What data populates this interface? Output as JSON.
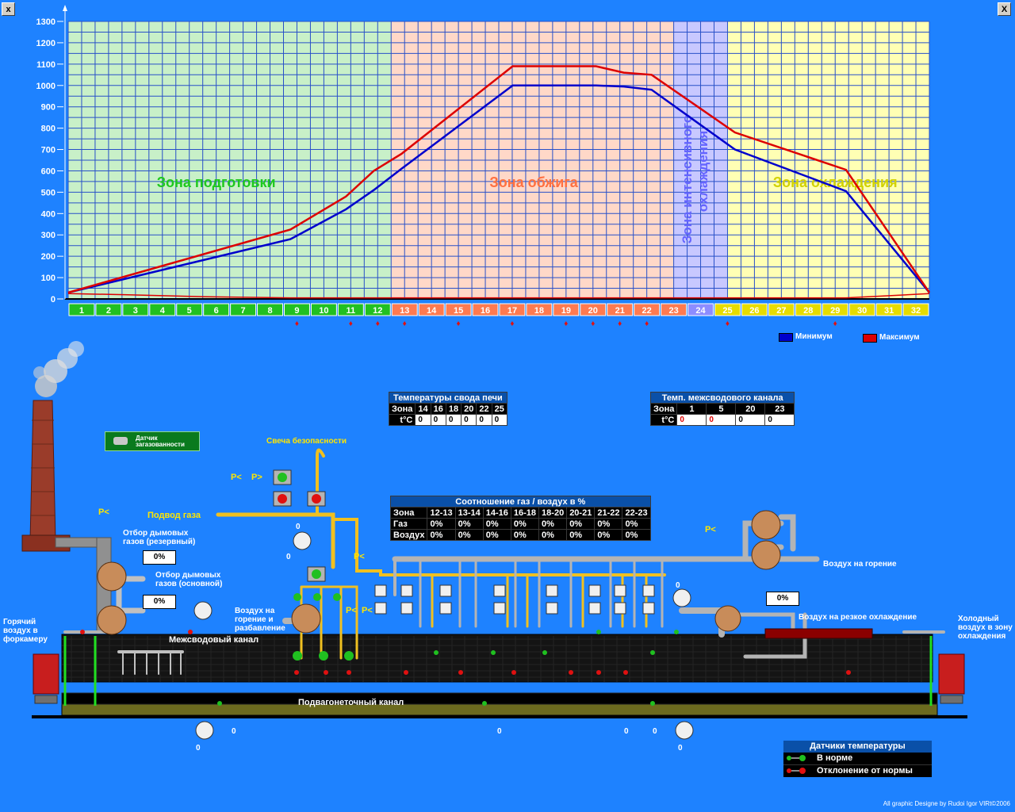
{
  "window": {
    "close_left": "x",
    "close_right": "X"
  },
  "chart_data": {
    "type": "line",
    "x": [
      1,
      2,
      3,
      4,
      5,
      6,
      7,
      8,
      9,
      10,
      11,
      12,
      13,
      14,
      15,
      16,
      17,
      18,
      19,
      20,
      21,
      22,
      23,
      24,
      25,
      26,
      27,
      28,
      29,
      30,
      31,
      32
    ],
    "categories": [
      "1",
      "2",
      "3",
      "4",
      "5",
      "6",
      "7",
      "8",
      "9",
      "10",
      "11",
      "12",
      "13",
      "14",
      "15",
      "16",
      "17",
      "18",
      "19",
      "20",
      "21",
      "22",
      "23",
      "24",
      "25",
      "26",
      "27",
      "28",
      "29",
      "30",
      "31",
      "32"
    ],
    "ylim": [
      0,
      1300
    ],
    "yticks": [
      0,
      100,
      200,
      300,
      400,
      500,
      600,
      700,
      800,
      900,
      1000,
      1100,
      1200,
      1300
    ],
    "grid": true,
    "legend_position": "bottom-right",
    "series": [
      {
        "name": "Минимум",
        "color": "#0000cc",
        "points": [
          [
            1,
            30
          ],
          [
            9,
            280
          ],
          [
            11,
            420
          ],
          [
            12,
            510
          ],
          [
            13,
            610
          ],
          [
            17,
            1000
          ],
          [
            20,
            1000
          ],
          [
            21,
            995
          ],
          [
            22,
            980
          ],
          [
            25,
            700
          ],
          [
            29,
            505
          ],
          [
            32,
            30
          ]
        ]
      },
      {
        "name": "Максимум",
        "color": "#dd0000",
        "points": [
          [
            1,
            30
          ],
          [
            9,
            325
          ],
          [
            11,
            480
          ],
          [
            12,
            600
          ],
          [
            13,
            680
          ],
          [
            17,
            1090
          ],
          [
            20,
            1090
          ],
          [
            21,
            1060
          ],
          [
            22,
            1050
          ],
          [
            25,
            780
          ],
          [
            29,
            605
          ],
          [
            32,
            30
          ]
        ]
      },
      {
        "name": "",
        "color": "#dd0000",
        "points": [
          [
            1,
            25
          ],
          [
            3,
            20
          ],
          [
            6,
            10
          ],
          [
            9,
            5
          ],
          [
            29,
            5
          ],
          [
            32,
            25
          ]
        ]
      }
    ],
    "zones": [
      {
        "label": "Зона подготовки",
        "from": 1,
        "to": 12,
        "color": "#c8f0c8",
        "label_color": "#1ec81e"
      },
      {
        "label": "Зона обжига",
        "from": 13,
        "to": 23,
        "color": "#ffd8c8",
        "label_color": "#ff7040"
      },
      {
        "label": "Зона интенсивного охлаждения",
        "from": 24,
        "to": 24,
        "color": "#c8c8ff",
        "label_color": "#6464ff"
      },
      {
        "label": "Зона охлаждения",
        "from": 25,
        "to": 32,
        "color": "#ffffb4",
        "label_color": "#d2d200"
      }
    ],
    "marked_positions": [
      9,
      11,
      12,
      13,
      15,
      17,
      19,
      20,
      21,
      22,
      25,
      29
    ]
  },
  "legend": {
    "min_label": "Минимум",
    "max_label": "Максимум",
    "min_color": "#0000cc",
    "max_color": "#dd0000"
  },
  "vault_temps": {
    "title": "Температуры свода печи",
    "zone_label": "Зона",
    "temp_label": "t°C",
    "zones": [
      "14",
      "16",
      "18",
      "20",
      "22",
      "25"
    ],
    "values": [
      "0",
      "0",
      "0",
      "0",
      "0",
      "0"
    ]
  },
  "channel_temps": {
    "title": "Темп. межсводового канала",
    "zone_label": "Зона",
    "temp_label": "t°C",
    "zones": [
      "1",
      "5",
      "20",
      "23"
    ],
    "values": [
      "0",
      "0",
      "0",
      "0"
    ]
  },
  "gas_air": {
    "title": "Соотношение газ / воздух в %",
    "zone_label": "Зона",
    "gas_label": "Газ",
    "air_label": "Воздух",
    "zones": [
      "12-13",
      "13-14",
      "14-16",
      "16-18",
      "18-20",
      "20-21",
      "21-22",
      "22-23"
    ],
    "gas": [
      "0%",
      "0%",
      "0%",
      "0%",
      "0%",
      "0%",
      "0%",
      "0%"
    ],
    "air": [
      "0%",
      "0%",
      "0%",
      "0%",
      "0%",
      "0%",
      "0%",
      "0%"
    ]
  },
  "kiln": {
    "gas_sensor": "Датчик загазованности",
    "safety_candle": "Свеча безопасности",
    "gas_supply": "Подвод газа",
    "flue_reserve": "Отбор дымовых газов (резервный)",
    "flue_main": "Отбор дымовых газов (основной)",
    "hot_air": "Горячий воздух в форкамеру",
    "burn_air_dilution": "Воздух на горение и разбавление",
    "burn_air": "Воздух на горение",
    "quick_cool_air": "Воздух на резкое охлаждение",
    "cold_air": "Холодный воздух в зону охлаждения",
    "intervault_channel": "Межсводовый канал",
    "undercar_channel": "Подвагонеточный канал",
    "pct_reserve": "0%",
    "pct_main": "0%",
    "pct_quick": "0%",
    "pressure_symbol_less": "P<",
    "pressure_symbol_more": "P>",
    "zero": "0",
    "positions": [
      "1",
      "2",
      "3",
      "4",
      "5",
      "6",
      "7",
      "8",
      "9",
      "10",
      "11",
      "12",
      "13",
      "14",
      "15",
      "16",
      "17",
      "18",
      "19",
      "20",
      "21",
      "22",
      "23",
      "24",
      "25",
      "26",
      "27",
      "28",
      "29",
      "30",
      "31",
      "32"
    ]
  },
  "sensors_legend": {
    "title": "Датчики температуры",
    "normal": "В норме",
    "deviation": "Отклонение от нормы"
  },
  "credit": "All graphic Designe by Rudoi Igor  VIRt©2006"
}
